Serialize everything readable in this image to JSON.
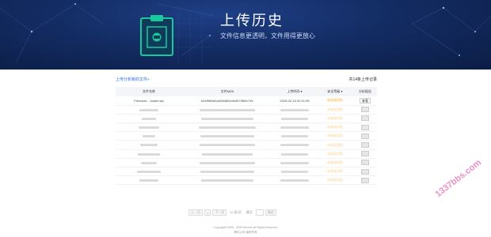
{
  "banner": {
    "title": "上传历史",
    "subtitle": "文件信息更透明，文件用得更放心"
  },
  "toolbar": {
    "link": "上传分析新的文件»",
    "count": "共14条上传记录"
  },
  "table": {
    "headers": [
      "文件名称",
      "文件MD5",
      "上传时间",
      "安全等级",
      "分析报告"
    ],
    "sort_icon": "▾",
    "first_row": {
      "name": "Freedom....loader.zip",
      "md5": "b44f989a0cd05e665c5d4679f60c7b1",
      "time": "2025-02-15 02:41:05",
      "status": "未发现风险",
      "action": "查看"
    },
    "blurred_status": "未发现风险"
  },
  "pager": {
    "prev": "上一页",
    "next": "下一页",
    "page": "1",
    "per_page": "10 条/页",
    "goto": "跳至",
    "go": "确定"
  },
  "footer": {
    "line1": "Copyright©1998 - 2025 Tencent All Rights Reserved",
    "line2": "腾讯公司 版权所有"
  },
  "watermark": "1337bbs.com",
  "colors": {
    "accent": "#2b6ed9",
    "warning": "#f5a623",
    "banner": "#132c63",
    "brand_green": "#19c99b"
  }
}
